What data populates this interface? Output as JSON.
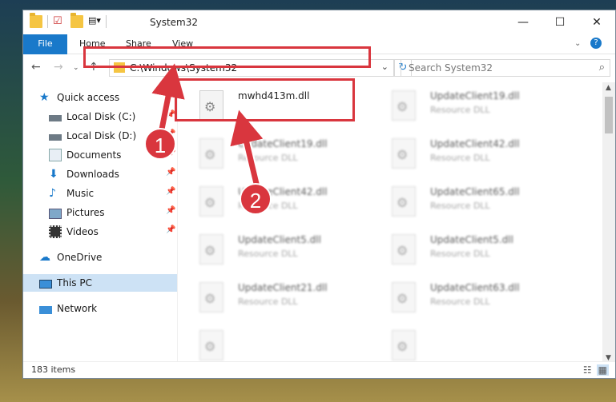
{
  "window": {
    "title": "System32"
  },
  "ribbon": {
    "tabs": [
      "File",
      "Home",
      "Share",
      "View"
    ]
  },
  "navigation": {
    "address": "C:\\Windows\\System32",
    "search_placeholder": "Search System32"
  },
  "sidebar": {
    "items": [
      {
        "label": "Quick access",
        "icon": "star-icon"
      },
      {
        "label": "Local Disk (C:)",
        "icon": "drive-icon"
      },
      {
        "label": "Local Disk (D:)",
        "icon": "drive-icon"
      },
      {
        "label": "Documents",
        "icon": "documents-icon"
      },
      {
        "label": "Downloads",
        "icon": "download-icon"
      },
      {
        "label": "Music",
        "icon": "music-icon"
      },
      {
        "label": "Pictures",
        "icon": "pictures-icon"
      },
      {
        "label": "Videos",
        "icon": "videos-icon"
      },
      {
        "label": "OneDrive",
        "icon": "cloud-icon"
      },
      {
        "label": "This PC",
        "icon": "computer-icon"
      },
      {
        "label": "Network",
        "icon": "network-icon"
      }
    ]
  },
  "files": [
    {
      "name": "mwhd413m.dll",
      "type": ""
    },
    {
      "name": "UpdateClient19.dll",
      "type": "Resource DLL"
    },
    {
      "name": "UpdateClient19.dll",
      "type": "Resource DLL"
    },
    {
      "name": "UpdateClient42.dll",
      "type": "Resource DLL"
    },
    {
      "name": "UpdateClient42.dll",
      "type": "Resource DLL"
    },
    {
      "name": "UpdateClient65.dll",
      "type": "Resource DLL"
    },
    {
      "name": "UpdateClient5.dll",
      "type": "Resource DLL"
    },
    {
      "name": "UpdateClient5.dll",
      "type": "Resource DLL"
    },
    {
      "name": "UpdateClient21.dll",
      "type": "Resource DLL"
    },
    {
      "name": "UpdateClient63.dll",
      "type": "Resource DLL"
    }
  ],
  "status": {
    "item_count": "183 items"
  },
  "callouts": [
    "1",
    "2"
  ],
  "colors": {
    "accent": "#1979ca",
    "highlight": "#d9363e"
  }
}
